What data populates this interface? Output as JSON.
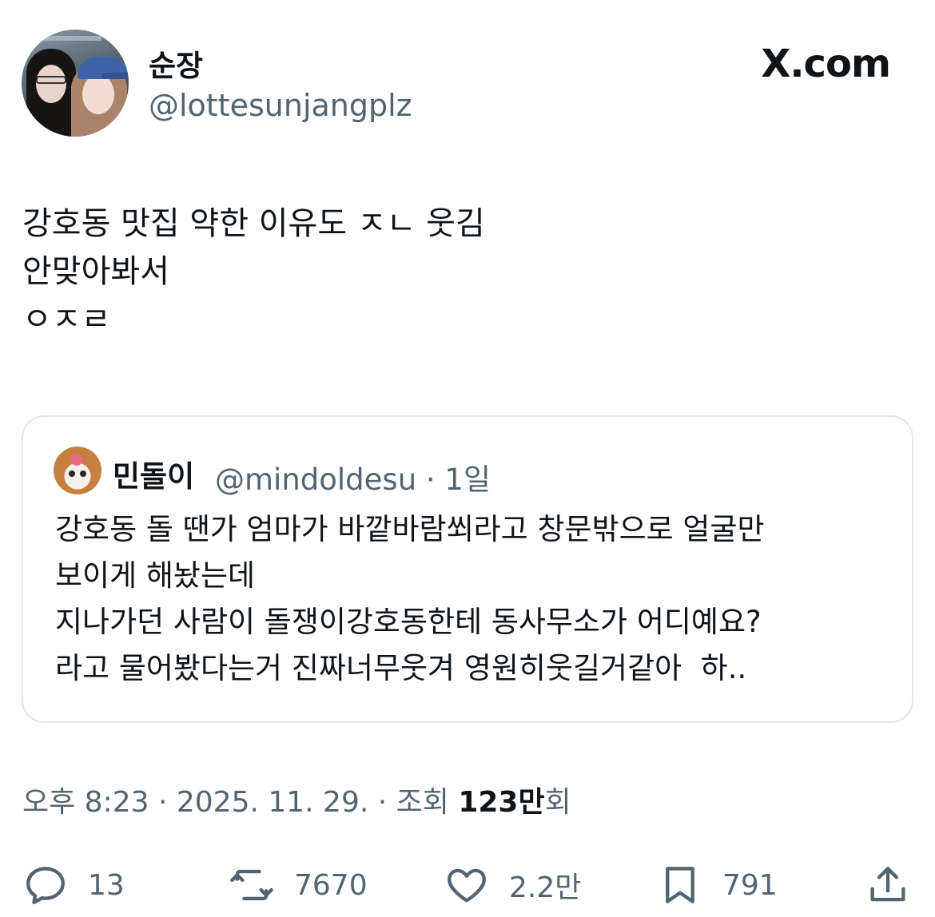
{
  "author": {
    "display_name": "순장",
    "handle": "@lottesunjangplz"
  },
  "brand": {
    "label": "X.com",
    "icon": "x-logo-icon"
  },
  "tweet": {
    "lines": [
      "강호동 맛집 약한 이유도 ㅈㄴ 웃김",
      "안맞아봐서",
      "ㅇㅈㄹ"
    ]
  },
  "quote": {
    "display_name": "민돌이",
    "meta": "@mindoldesu · 1일",
    "lines": [
      "강호동 돌 땐가 엄마가 바깥바람쐬라고 창문밖으로 얼굴만",
      "보이게 해놨는데",
      "지나가던 사람이 돌쟁이강호동한테 동사무소가 어디예요?",
      "라고 물어봤다는거 진짜너무웃겨 영원히웃길거같아  하.."
    ]
  },
  "meta": {
    "time_date": "오후 8:23 · 2025. 11. 29. · 조회 ",
    "views_number": "123만",
    "views_suffix": "회"
  },
  "actions": {
    "reply": {
      "icon": "reply-icon",
      "count": "13"
    },
    "retweet": {
      "icon": "retweet-icon",
      "count": "7670"
    },
    "like": {
      "icon": "heart-icon",
      "count": "2.2만"
    },
    "bookmark": {
      "icon": "bookmark-icon",
      "count": "791"
    },
    "share": {
      "icon": "share-icon"
    }
  }
}
